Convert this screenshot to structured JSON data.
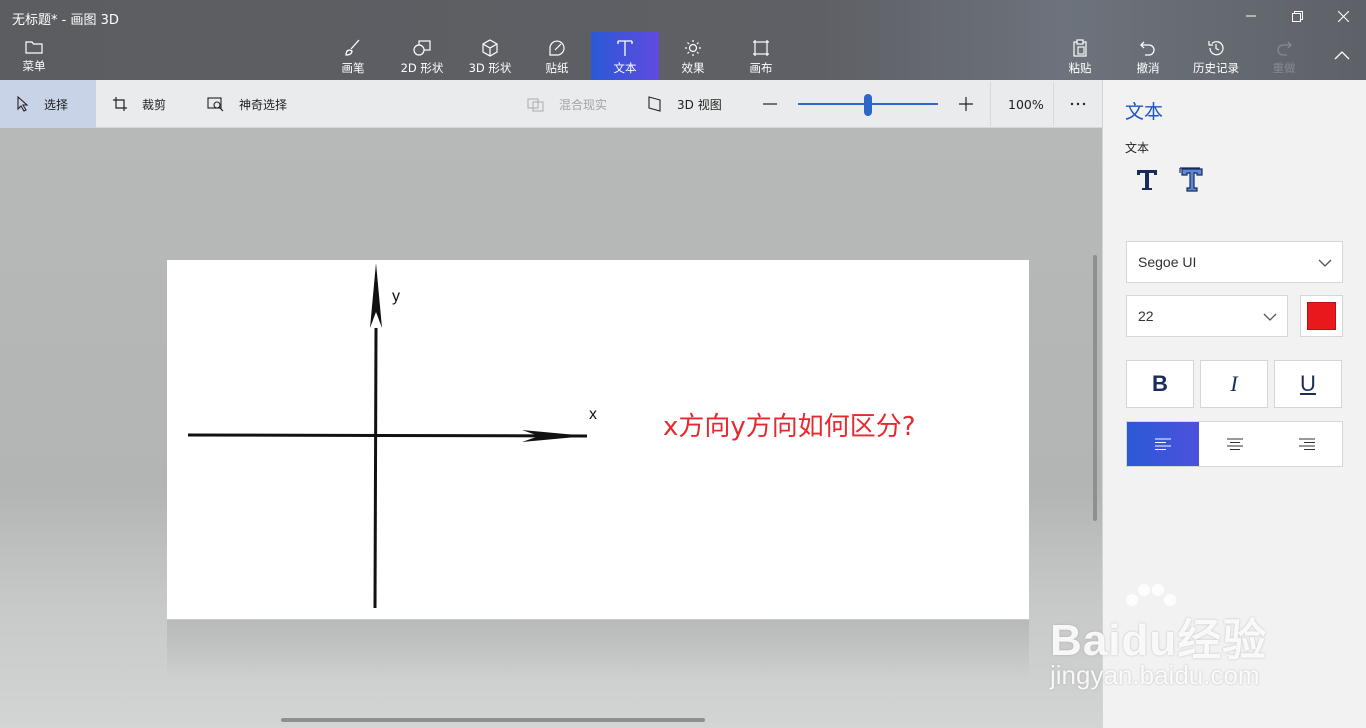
{
  "window": {
    "title": "无标题* - 画图 3D"
  },
  "ribbon": {
    "menu": "菜单",
    "tools": [
      {
        "label": "画笔",
        "icon": "brush-icon"
      },
      {
        "label": "2D 形状",
        "icon": "2d-shapes-icon"
      },
      {
        "label": "3D 形状",
        "icon": "3d-shapes-icon"
      },
      {
        "label": "贴纸",
        "icon": "stickers-icon"
      },
      {
        "label": "文本",
        "icon": "text-icon",
        "active": true
      },
      {
        "label": "效果",
        "icon": "effects-icon"
      },
      {
        "label": "画布",
        "icon": "canvas-icon"
      }
    ],
    "paste": "粘贴",
    "undo": "撤消",
    "history": "历史记录",
    "redo": "重做"
  },
  "subbar": {
    "select": "选择",
    "crop": "裁剪",
    "magic_select": "神奇选择",
    "mixed_reality": "混合现实",
    "view_3d": "3D 视图",
    "zoom": {
      "percent_label": "100%",
      "slider_level": 0.5
    }
  },
  "canvas": {
    "y_label": "y",
    "x_label": "x",
    "question": "x方向y方向如何区分?"
  },
  "panel": {
    "title": "文本",
    "subtitle": "文本",
    "font_family": "Segoe UI",
    "font_size": "22",
    "text_color": "#e8181c",
    "bold": "B",
    "italic": "I",
    "underline": "U",
    "alignment": "left"
  },
  "watermark": {
    "brand": "Baidu经验",
    "domain": "jingyan.baidu.com"
  },
  "colors": {
    "accent": "#2b59d6",
    "question_text": "#e8282c"
  }
}
